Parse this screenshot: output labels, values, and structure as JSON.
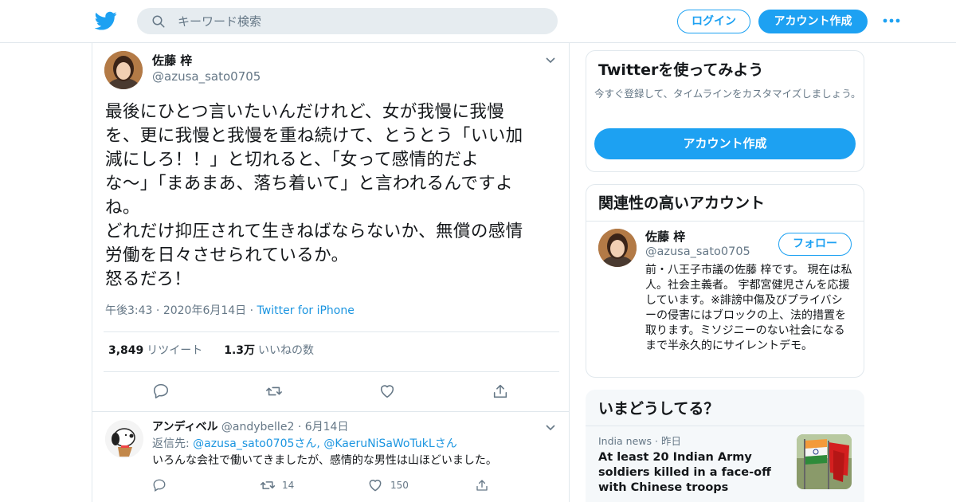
{
  "header": {
    "search_placeholder": "キーワード検索",
    "login_label": "ログイン",
    "signup_label": "アカウント作成",
    "brand_color": "#1da1f2"
  },
  "tweet": {
    "author_name": "佐藤 梓",
    "author_handle": "@azusa_sato0705",
    "text": "最後にひとつ言いたいんだけれど、女が我慢に我慢\nを、更に我慢と我慢を重ね続けて、とうとう「いい加\n減にしろ！！」と切れると、「女って感情的だよ\nな〜」「まあまあ、落ち着いて」と言われるんですよ\nね。\nどれだけ抑圧されて生きねばならないか、無償の感情\n労働を日々させられているか。\n怒るだろ！",
    "time": "午後3:43",
    "date": "2020年6月14日",
    "source": "Twitter for iPhone",
    "retweets_count": "3,849",
    "retweets_label": "リツイート",
    "likes_count": "1.3万",
    "likes_label": "いいねの数"
  },
  "reply": {
    "name": "アンディベル",
    "handle": "@andybelle2",
    "date": "6月14日",
    "reply_to_prefix": "返信先: ",
    "reply_to_user1": "@azusa_sato0705",
    "reply_to_mid": "さん, ",
    "reply_to_user2": "@KaeruNiSaWoTukL",
    "reply_to_suffix": "さん",
    "text": "いろんな会社で働いてきましたが、感情的な男性は山ほどいました。",
    "retweets": "14",
    "likes": "150"
  },
  "signup_card": {
    "title": "Twitterを使ってみよう",
    "subtitle": "今すぐ登録して、タイムラインをカスタマイズしましょう。",
    "button_label": "アカウント作成"
  },
  "related_card": {
    "title": "関連性の高いアカウント",
    "name": "佐藤 梓",
    "handle": "@azusa_sato0705",
    "follow_label": "フォロー",
    "bio": "前・八王子市議の佐藤 梓です。 現在は私人。社会主義者。 宇都宮健児さんを応援しています。※誹謗中傷及びプライバシーの侵害にはブロックの上、法的措置を取ります。ミソジニーのない社会になるまで半永久的にサイレントデモ。"
  },
  "trends_card": {
    "title": "いまどうしてる？",
    "source": "India news",
    "time": "昨日",
    "headline": "At least 20 Indian Army soldiers killed in a face-off with Chinese troops"
  },
  "icons": [
    "twitter-bird-icon",
    "search-icon",
    "more-dots-icon",
    "chevron-down-icon",
    "reply-icon",
    "retweet-icon",
    "like-heart-icon",
    "share-icon"
  ]
}
